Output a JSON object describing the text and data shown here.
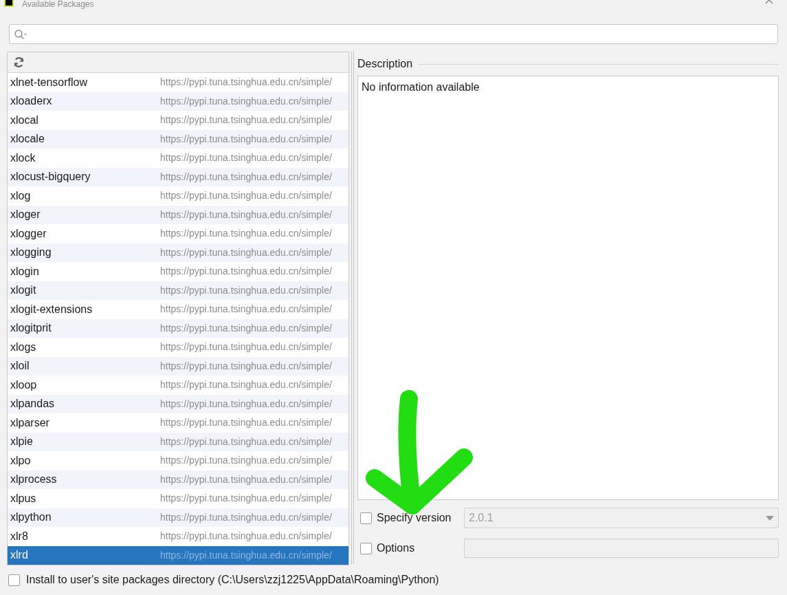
{
  "window": {
    "title": "Available Packages"
  },
  "packages": [
    {
      "name": "xlnet-tensorflow",
      "repository": "https://pypi.tuna.tsinghua.edu.cn/simple/",
      "selected": false
    },
    {
      "name": "xloaderx",
      "repository": "https://pypi.tuna.tsinghua.edu.cn/simple/",
      "selected": false
    },
    {
      "name": "xlocal",
      "repository": "https://pypi.tuna.tsinghua.edu.cn/simple/",
      "selected": false
    },
    {
      "name": "xlocale",
      "repository": "https://pypi.tuna.tsinghua.edu.cn/simple/",
      "selected": false
    },
    {
      "name": "xlock",
      "repository": "https://pypi.tuna.tsinghua.edu.cn/simple/",
      "selected": false
    },
    {
      "name": "xlocust-bigquery",
      "repository": "https://pypi.tuna.tsinghua.edu.cn/simple/",
      "selected": false
    },
    {
      "name": "xlog",
      "repository": "https://pypi.tuna.tsinghua.edu.cn/simple/",
      "selected": false
    },
    {
      "name": "xloger",
      "repository": "https://pypi.tuna.tsinghua.edu.cn/simple/",
      "selected": false
    },
    {
      "name": "xlogger",
      "repository": "https://pypi.tuna.tsinghua.edu.cn/simple/",
      "selected": false
    },
    {
      "name": "xlogging",
      "repository": "https://pypi.tuna.tsinghua.edu.cn/simple/",
      "selected": false
    },
    {
      "name": "xlogin",
      "repository": "https://pypi.tuna.tsinghua.edu.cn/simple/",
      "selected": false
    },
    {
      "name": "xlogit",
      "repository": "https://pypi.tuna.tsinghua.edu.cn/simple/",
      "selected": false
    },
    {
      "name": "xlogit-extensions",
      "repository": "https://pypi.tuna.tsinghua.edu.cn/simple/",
      "selected": false
    },
    {
      "name": "xlogitprit",
      "repository": "https://pypi.tuna.tsinghua.edu.cn/simple/",
      "selected": false
    },
    {
      "name": "xlogs",
      "repository": "https://pypi.tuna.tsinghua.edu.cn/simple/",
      "selected": false
    },
    {
      "name": "xloil",
      "repository": "https://pypi.tuna.tsinghua.edu.cn/simple/",
      "selected": false
    },
    {
      "name": "xloop",
      "repository": "https://pypi.tuna.tsinghua.edu.cn/simple/",
      "selected": false
    },
    {
      "name": "xlpandas",
      "repository": "https://pypi.tuna.tsinghua.edu.cn/simple/",
      "selected": false
    },
    {
      "name": "xlparser",
      "repository": "https://pypi.tuna.tsinghua.edu.cn/simple/",
      "selected": false
    },
    {
      "name": "xlpie",
      "repository": "https://pypi.tuna.tsinghua.edu.cn/simple/",
      "selected": false
    },
    {
      "name": "xlpo",
      "repository": "https://pypi.tuna.tsinghua.edu.cn/simple/",
      "selected": false
    },
    {
      "name": "xlprocess",
      "repository": "https://pypi.tuna.tsinghua.edu.cn/simple/",
      "selected": false
    },
    {
      "name": "xlpus",
      "repository": "https://pypi.tuna.tsinghua.edu.cn/simple/",
      "selected": false
    },
    {
      "name": "xlpython",
      "repository": "https://pypi.tuna.tsinghua.edu.cn/simple/",
      "selected": false
    },
    {
      "name": "xlr8",
      "repository": "https://pypi.tuna.tsinghua.edu.cn/simple/",
      "selected": false
    },
    {
      "name": "xlrd",
      "repository": "https://pypi.tuna.tsinghua.edu.cn/simple/",
      "selected": true
    }
  ],
  "description": {
    "heading": "Description",
    "text": "No information available"
  },
  "specify_version": {
    "label": "Specify version",
    "checked": false,
    "value": "2.0.1"
  },
  "options": {
    "label": "Options",
    "checked": false
  },
  "install_user": {
    "label": "Install to user's site packages directory (C:\\Users\\zzj1225\\AppData\\Roaming\\Python)",
    "checked": false
  }
}
